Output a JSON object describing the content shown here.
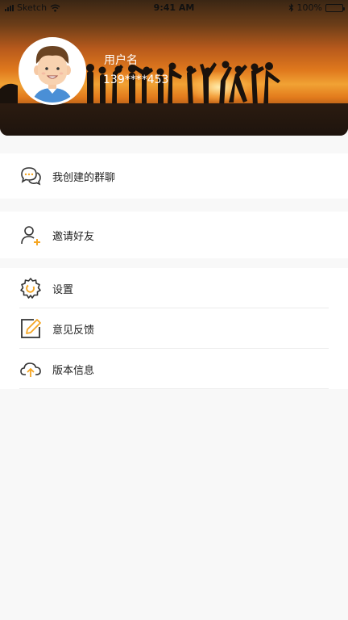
{
  "status_bar": {
    "carrier": "Sketch",
    "time": "9:41 AM",
    "battery": "100%"
  },
  "profile": {
    "username": "用户名",
    "phone": "139****453"
  },
  "menu": {
    "group_chats": "我创建的群聊",
    "invite_friends": "邀请好友",
    "settings": "设置",
    "feedback": "意见反馈",
    "version_info": "版本信息"
  },
  "colors": {
    "accent": "#f5a623",
    "icon_stroke": "#333333",
    "header_orange": "#e0791d"
  },
  "icons": {
    "chat": "chat-bubbles-icon",
    "invite": "add-user-icon",
    "settings": "gear-icon",
    "feedback": "edit-icon",
    "version": "cloud-upload-icon"
  }
}
